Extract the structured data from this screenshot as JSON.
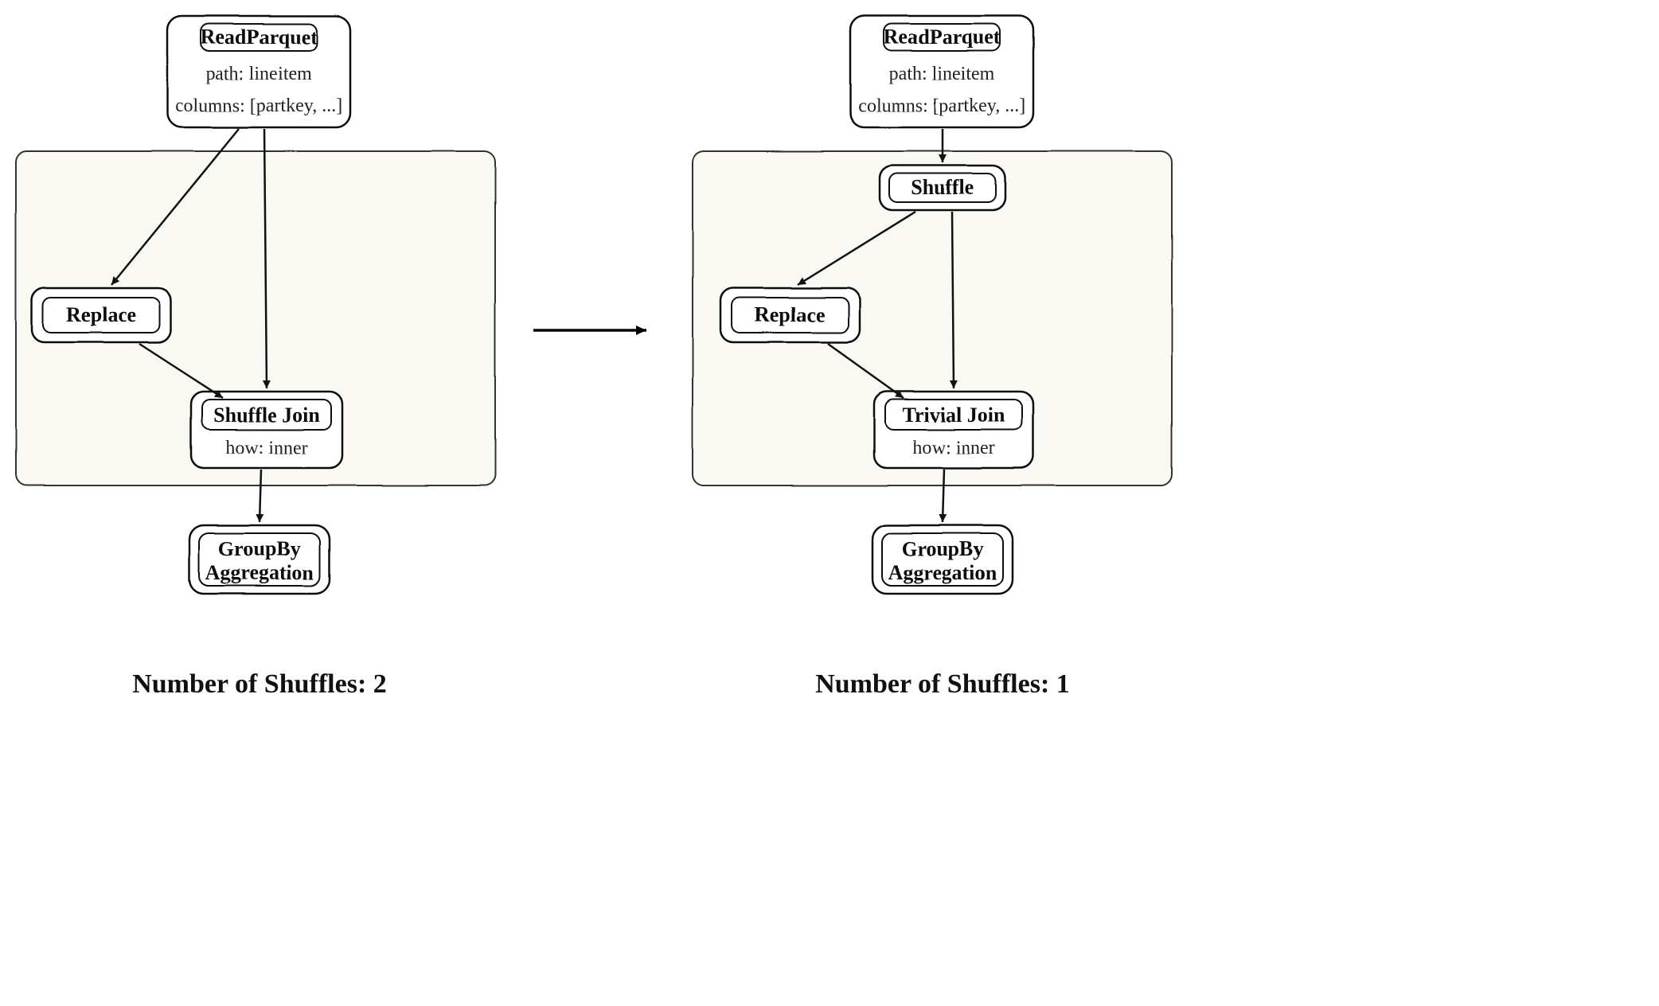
{
  "left": {
    "readParquet": {
      "title": "ReadParquet",
      "path": "path: lineitem",
      "columns": "columns: [partkey, ...]"
    },
    "replace": {
      "title": "Replace"
    },
    "join": {
      "title": "Shuffle Join",
      "how": "how: inner"
    },
    "groupby": {
      "line1": "GroupBy",
      "line2": "Aggregation"
    },
    "caption": "Number of Shuffles: 2"
  },
  "right": {
    "readParquet": {
      "title": "ReadParquet",
      "path": "path: lineitem",
      "columns": "columns: [partkey, ...]"
    },
    "shuffle": {
      "title": "Shuffle"
    },
    "replace": {
      "title": "Replace"
    },
    "join": {
      "title": "Trivial Join",
      "how": "how: inner"
    },
    "groupby": {
      "line1": "GroupBy",
      "line2": "Aggregation"
    },
    "caption": "Number of Shuffles: 1"
  }
}
